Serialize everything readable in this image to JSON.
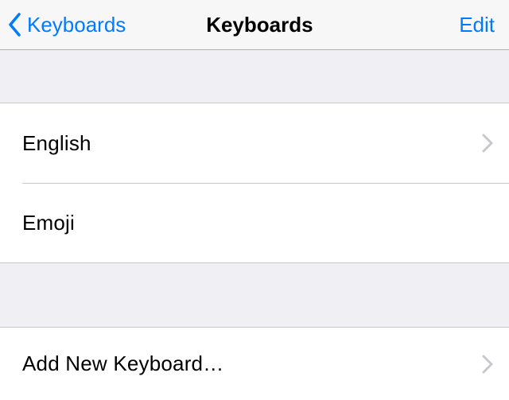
{
  "nav": {
    "back_label": "Keyboards",
    "title": "Keyboards",
    "edit_label": "Edit"
  },
  "keyboards": [
    {
      "label": "English",
      "disclosure": true
    },
    {
      "label": "Emoji",
      "disclosure": false
    }
  ],
  "add": {
    "label": "Add New Keyboard…",
    "disclosure": true
  }
}
